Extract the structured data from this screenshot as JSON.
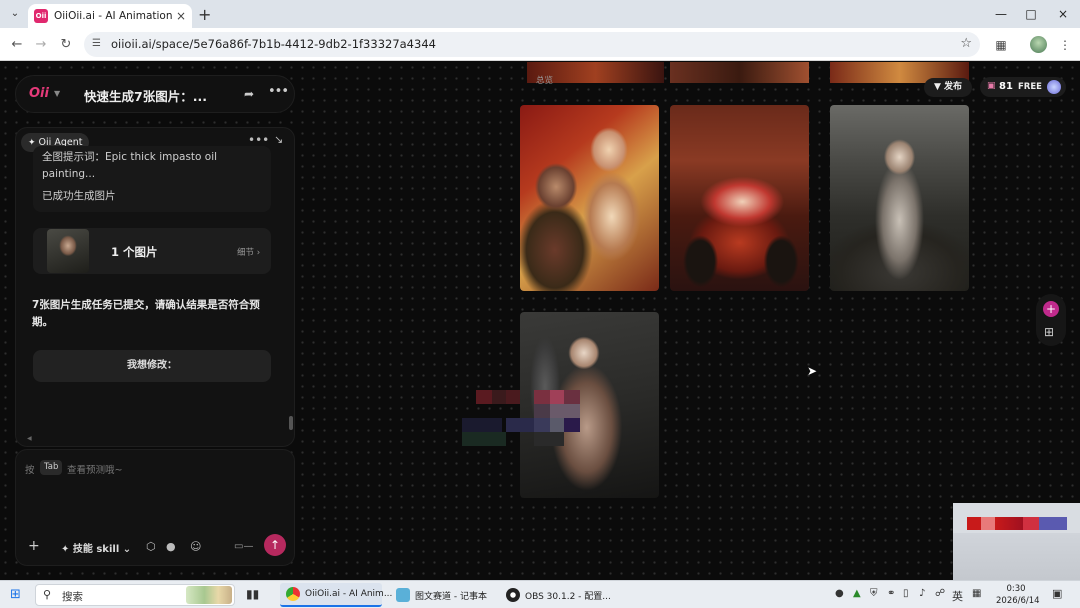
{
  "browser": {
    "tab_title": "OiiOii.ai - AI Animation agent",
    "tab_favicon": "Oii",
    "url": "oiioii.ai/space/5e76a86f-7b1b-4412-9db2-1f33327a4344"
  },
  "app": {
    "logo": "Oii",
    "project_title": "快速生成7张图片：...",
    "agent_badge": "Oii Agent",
    "chat": {
      "prompt_excerpt": "全图提示词：Epic thick impasto oil painting...",
      "success_message": "已成功生成图片",
      "image_card_label": "1 个图片",
      "image_card_detail": "细节",
      "agent_message": "7张图片生成任务已提交，请确认结果是否符合预期。",
      "modify_button": "我想修改："
    },
    "composer": {
      "hint_prefix": "按",
      "hint_key": "Tab",
      "hint_suffix": "查看预测哦~",
      "skill_label": "技能 skill"
    },
    "canvas": {
      "overview_label": "总览",
      "publish_label": "发布",
      "credits": "81",
      "plan": "FREE"
    },
    "colors": {
      "accent": "#e63a7a",
      "send": "#b6295e",
      "add_tool": "#c02a8c"
    }
  },
  "taskbar": {
    "search_placeholder": "搜索",
    "items": [
      {
        "label": "OiiOii.ai - AI Anim...",
        "icon": "chrome-icon"
      },
      {
        "label": "图文赛道 - 记事本",
        "icon": "notepad-icon"
      },
      {
        "label": "OBS 30.1.2 - 配置...",
        "icon": "obs-icon"
      }
    ],
    "ime": "英",
    "time": "0:30",
    "date": "2026/6/14"
  }
}
